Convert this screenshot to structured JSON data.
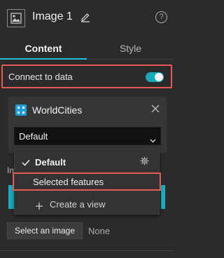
{
  "header": {
    "title": "Image 1"
  },
  "tabs": [
    {
      "label": "Content"
    },
    {
      "label": "Style"
    }
  ],
  "connect": {
    "label": "Connect to data",
    "enabled": true
  },
  "data_source": {
    "name": "WorldCities",
    "view_select": {
      "value": "Default"
    }
  },
  "dropdown": {
    "items": [
      {
        "label": "Default",
        "selected": true
      },
      {
        "label": "Selected features"
      },
      {
        "label": "Create a view"
      }
    ]
  },
  "obscured": {
    "label_fragment": "Im"
  },
  "image_source": {
    "button_label": "Select an image",
    "value": "None"
  },
  "colors": {
    "accent": "#1ec0d2",
    "highlight": "#e35a55",
    "datasource": "#1e9fd8"
  },
  "icons": [
    "image-icon",
    "pencil-icon",
    "help-icon",
    "close-icon",
    "chevron-down-icon",
    "check-icon",
    "gear-icon",
    "plus-icon"
  ]
}
